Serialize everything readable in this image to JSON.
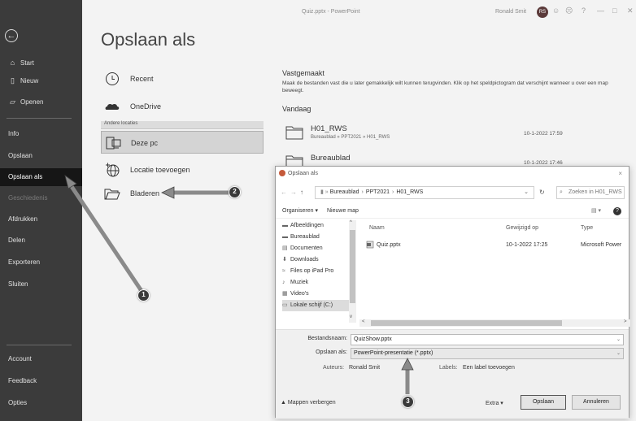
{
  "titlebar": {
    "doc_title": "Quiz.pptx - PowerPoint",
    "user_name": "Ronald Smit",
    "user_initials": "RS",
    "icons": [
      "smile-icon",
      "frown-icon",
      "help-icon",
      "minimize-icon",
      "restore-icon",
      "close-icon"
    ]
  },
  "sidebar": {
    "back_icon": "back-arrow-icon",
    "items": [
      {
        "label": "Start",
        "icon": "home-icon"
      },
      {
        "label": "Nieuw",
        "icon": "new-file-icon"
      },
      {
        "label": "Openen",
        "icon": "open-folder-icon"
      },
      {
        "label": "Info"
      },
      {
        "label": "Opslaan"
      },
      {
        "label": "Opslaan als",
        "active": true
      },
      {
        "label": "Geschiedenis",
        "disabled": true
      },
      {
        "label": "Afdrukken"
      },
      {
        "label": "Delen"
      },
      {
        "label": "Exporteren"
      },
      {
        "label": "Sluiten"
      },
      {
        "label": "Account"
      },
      {
        "label": "Feedback"
      },
      {
        "label": "Opties"
      }
    ]
  },
  "page": {
    "title": "Opslaan als"
  },
  "locations": {
    "recent": "Recent",
    "onedrive": "OneDrive",
    "other_header": "Andere locaties",
    "this_pc": "Deze pc",
    "add_location": "Locatie toevoegen",
    "browse": "Bladeren"
  },
  "pinned": {
    "title": "Vastgemaakt",
    "description": "Maak de bestanden vast die u later gemakkelijk wilt kunnen terugvinden. Klik op het speldpictogram dat verschijnt wanneer u over een map beweegt."
  },
  "today": {
    "title": "Vandaag",
    "folders": [
      {
        "name": "H01_RWS",
        "path": "Bureaublad » PPT2021 » H01_RWS",
        "date": "10-1-2022 17:59"
      },
      {
        "name": "Bureaublad",
        "path": "",
        "date": "10-1-2022 17:46"
      }
    ]
  },
  "dialog": {
    "title": "Opslaan als",
    "close": "×",
    "breadcrumb": [
      "Bureaublad",
      "PPT2021",
      "H01_RWS"
    ],
    "search_placeholder": "Zoeken in H01_RWS",
    "organize": "Organiseren ▾",
    "new_folder": "Nieuwe map",
    "tree": [
      {
        "label": "Afbeeldingen",
        "icon": "pictures-icon"
      },
      {
        "label": "Bureaublad",
        "icon": "desktop-icon"
      },
      {
        "label": "Documenten",
        "icon": "documents-icon"
      },
      {
        "label": "Downloads",
        "icon": "downloads-icon"
      },
      {
        "label": "Files op iPad Pro",
        "icon": "network-icon"
      },
      {
        "label": "Muziek",
        "icon": "music-icon"
      },
      {
        "label": "Video's",
        "icon": "video-icon"
      },
      {
        "label": "Lokale schijf (C:)",
        "icon": "drive-icon",
        "selected": true
      }
    ],
    "columns": {
      "name": "Naam",
      "modified": "Gewijzigd op",
      "type": "Type"
    },
    "files": [
      {
        "name": "Quiz.pptx",
        "modified": "10-1-2022 17:25",
        "type": "Microsoft Power"
      }
    ],
    "filename_label": "Bestandsnaam:",
    "filename_value": "QuizShow.pptx",
    "savetype_label": "Opslaan als:",
    "savetype_value": "PowerPoint-presentatie (*.pptx)",
    "authors_label": "Auteurs:",
    "authors_value": "Ronald Smit",
    "labels_label": "Labels:",
    "labels_value": "Een label toevoegen",
    "hide_folders": "▲ Mappen verbergen",
    "tools": "Extra ▾",
    "save_button": "Opslaan",
    "cancel_button": "Annuleren"
  },
  "annotations": {
    "badge1": "1",
    "badge2": "2",
    "badge3": "3"
  }
}
